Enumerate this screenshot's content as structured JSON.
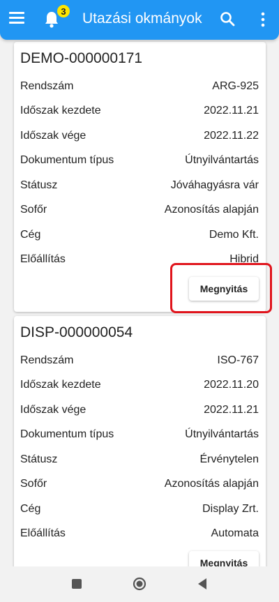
{
  "appbar": {
    "title": "Utazási okmányok",
    "notification_count": "3",
    "bg_color": "#2196f3"
  },
  "cards": [
    {
      "id": "DEMO-000000171",
      "rows": [
        {
          "label": "Rendszám",
          "value": "ARG-925"
        },
        {
          "label": "Időszak kezdete",
          "value": "2022.11.21"
        },
        {
          "label": "Időszak vége",
          "value": "2022.11.22"
        },
        {
          "label": "Dokumentum típus",
          "value": "Útnyilvántartás"
        },
        {
          "label": "Státusz",
          "value": "Jóváhagyásra vár"
        },
        {
          "label": "Sofőr",
          "value": "Azonosítás alapján"
        },
        {
          "label": "Cég",
          "value": "Demo Kft."
        },
        {
          "label": "Előállítás",
          "value": "Hibrid"
        }
      ],
      "button_label": "Megnyitás"
    },
    {
      "id": "DISP-000000054",
      "rows": [
        {
          "label": "Rendszám",
          "value": "ISO-767"
        },
        {
          "label": "Időszak kezdete",
          "value": "2022.11.20"
        },
        {
          "label": "Időszak vége",
          "value": "2022.11.21"
        },
        {
          "label": "Dokumentum típus",
          "value": "Útnyilvántartás"
        },
        {
          "label": "Státusz",
          "value": "Érvénytelen"
        },
        {
          "label": "Sofőr",
          "value": "Azonosítás alapján"
        },
        {
          "label": "Cég",
          "value": "Display Zrt."
        },
        {
          "label": "Előállítás",
          "value": "Automata"
        }
      ],
      "button_label": "Megnyitás"
    }
  ],
  "highlight_color": "#e0141c",
  "icons": [
    "menu-icon",
    "bell-icon",
    "search-icon",
    "more-vert-icon",
    "nav-recents-icon",
    "nav-home-icon",
    "nav-back-icon"
  ]
}
